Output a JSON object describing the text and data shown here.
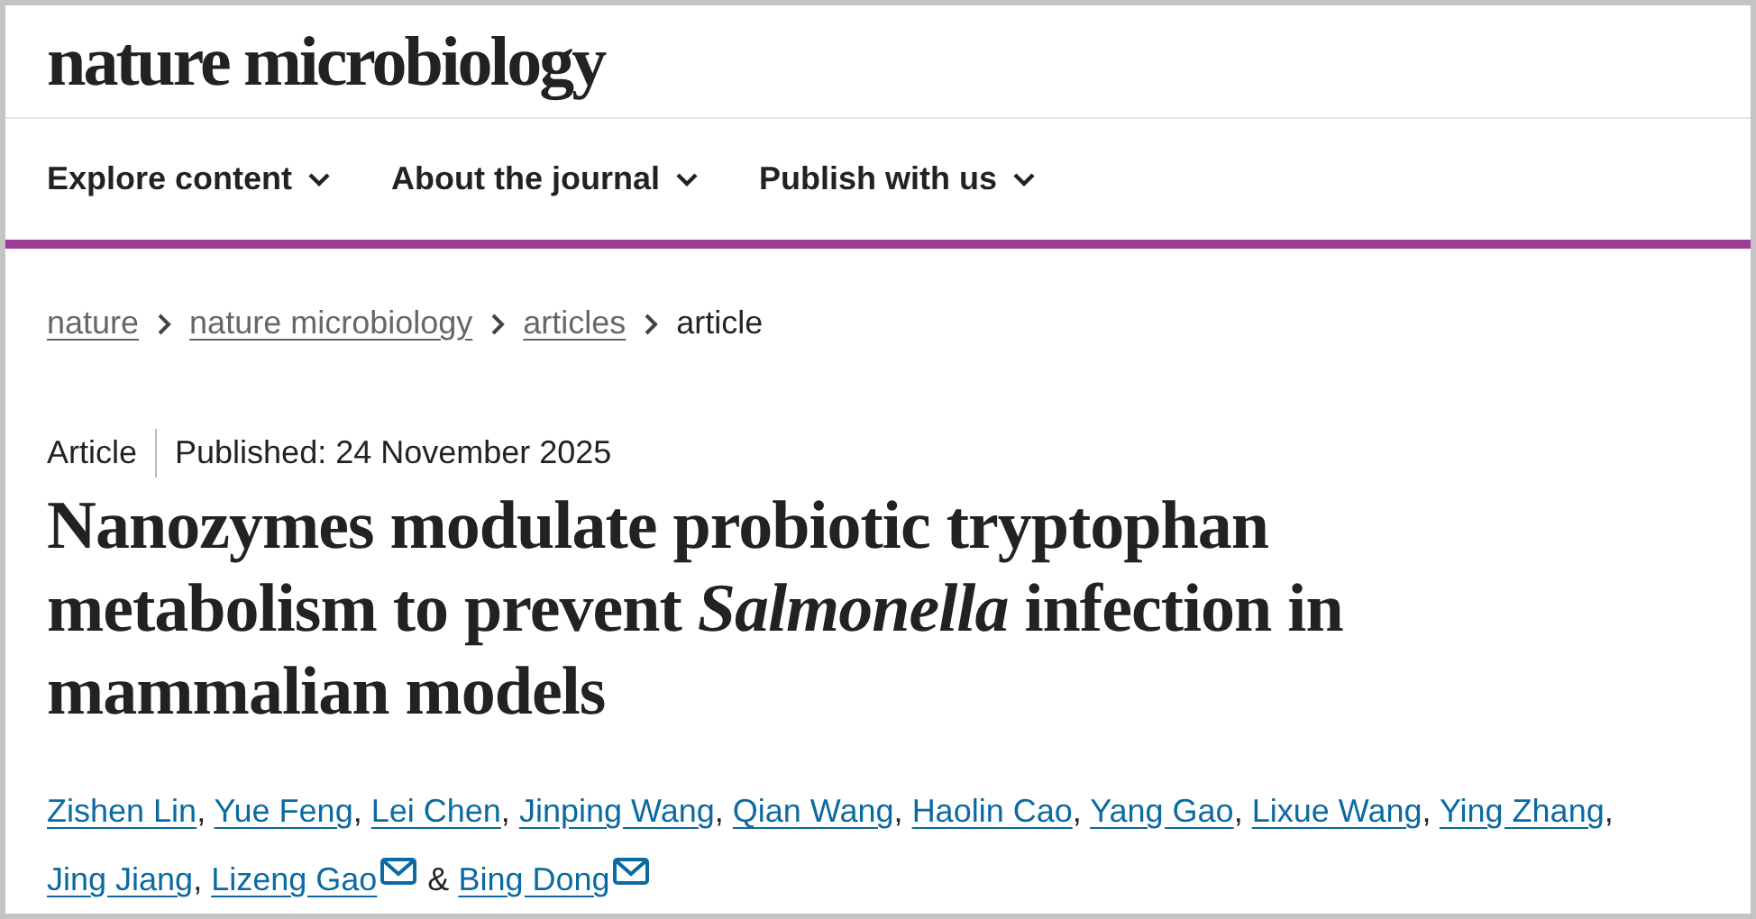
{
  "logo": "nature microbiology",
  "nav": [
    {
      "label": "Explore content",
      "expanded": false
    },
    {
      "label": "About the journal",
      "expanded": false
    },
    {
      "label": "Publish with us",
      "expanded": false
    }
  ],
  "breadcrumbs": [
    {
      "label": "nature",
      "kind": "link"
    },
    {
      "label": "nature microbiology",
      "kind": "link"
    },
    {
      "label": "articles",
      "kind": "link"
    },
    {
      "label": "article",
      "kind": "current"
    }
  ],
  "article": {
    "type": "Article",
    "published": "Published: 24 November 2025",
    "title": "Nanozymes modulate probiotic tryptophan metabolism to prevent *Salmonella* infection in mammalian models",
    "authors": [
      {
        "name": "Zishen Lin",
        "email": false,
        "separator": ","
      },
      {
        "name": "Yue Feng",
        "email": false,
        "separator": ","
      },
      {
        "name": "Lei Chen",
        "email": false,
        "separator": ","
      },
      {
        "name": "Jinping Wang",
        "email": false,
        "separator": ","
      },
      {
        "name": "Qian Wang",
        "email": false,
        "separator": ","
      },
      {
        "name": "Haolin Cao",
        "email": false,
        "separator": ","
      },
      {
        "name": "Yang Gao",
        "email": false,
        "separator": ","
      },
      {
        "name": "Lixue Wang",
        "email": false,
        "separator": ","
      },
      {
        "name": "Ying Zhang",
        "email": false,
        "separator": ","
      },
      {
        "name": "Jing Jiang",
        "email": false,
        "separator": ","
      },
      {
        "name": "Lizeng Gao",
        "email": true,
        "separator": "&"
      },
      {
        "name": "Bing Dong",
        "email": true
      }
    ]
  }
}
